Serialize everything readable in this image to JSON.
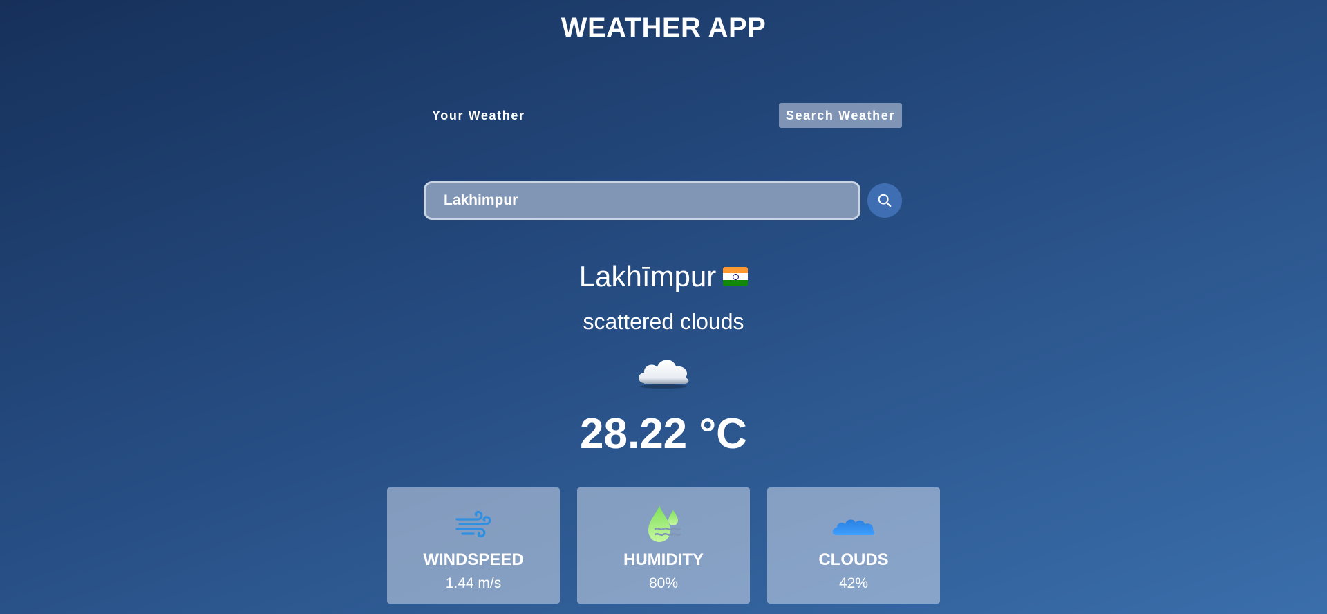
{
  "app": {
    "title": "WEATHER APP"
  },
  "tabs": [
    {
      "label": "Your Weather",
      "active": false
    },
    {
      "label": "Search Weather",
      "active": true
    }
  ],
  "search": {
    "value": "Lakhimpur",
    "icon": "search-icon"
  },
  "weather": {
    "city": "Lakhīmpur",
    "country_flag": "india-flag",
    "description": "scattered clouds",
    "condition_icon": "cloud-icon",
    "temperature": "28.22 °C"
  },
  "stats": [
    {
      "label": "WINDSPEED",
      "value": "1.44 m/s",
      "icon": "wind-icon"
    },
    {
      "label": "HUMIDITY",
      "value": "80%",
      "icon": "humidity-icon"
    },
    {
      "label": "CLOUDS",
      "value": "42%",
      "icon": "clouds-icon"
    }
  ],
  "colors": {
    "background_start": "#16305a",
    "background_end": "#3a6eab",
    "search_button": "#3f6fb2",
    "wind_icon": "#2f8fe0",
    "humidity_icon": "#a6f07a",
    "clouds_icon": "#1e90ff"
  }
}
